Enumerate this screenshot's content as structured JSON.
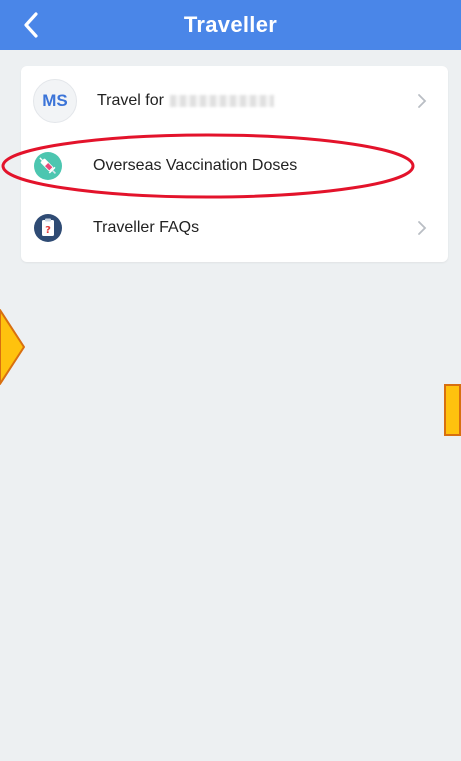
{
  "header": {
    "title": "Traveller",
    "background": "#4a86e8",
    "back_icon": "chevron-left-icon"
  },
  "menu": [
    {
      "avatar_text": "MS",
      "label": "Travel for",
      "name_redacted": true,
      "icon": "chevron-right-icon"
    },
    {
      "label": "Overseas Vaccination Doses",
      "icon": "syringe-icon"
    },
    {
      "label": "Traveller FAQs",
      "icon": "clipboard-question-icon",
      "chevron": "chevron-right-icon"
    }
  ],
  "annotation": {
    "color": "#e3132b",
    "highlight": "Overseas Vaccination Doses"
  }
}
